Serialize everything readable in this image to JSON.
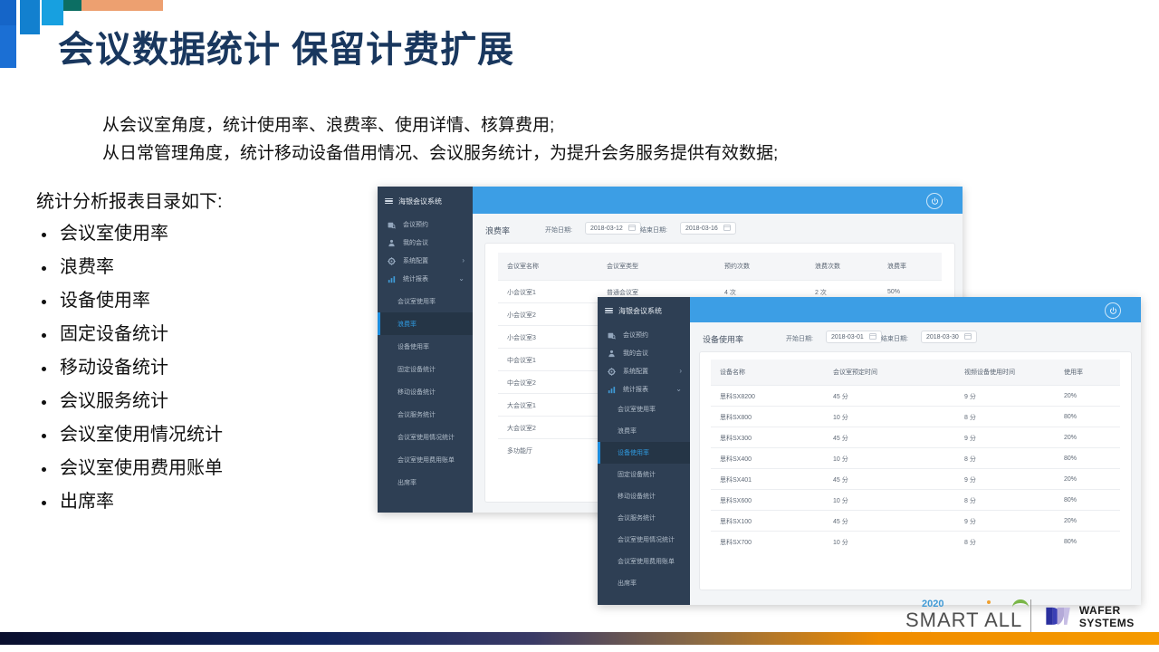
{
  "slide": {
    "title": "会议数据统计 保留计费扩展",
    "subtitle_line1": "从会议室角度，统计使用率、浪费率、使用详情、核算费用;",
    "subtitle_line2": "从日常管理角度，统计移动设备借用情况、会议服务统计，为提升会务服务提供有效数据;",
    "list_heading": "统计分析报表目录如下:",
    "bullets": [
      "会议室使用率",
      "浪费率",
      "设备使用率",
      "固定设备统计",
      "移动设备统计",
      "会议服务统计",
      "会议室使用情况统计",
      "会议室使用费用账单",
      "出席率"
    ]
  },
  "colors": {
    "title_navy": "#19375e",
    "accent_blue": "#3c9ee5",
    "sidebar_dark": "#2e3f54",
    "sidebar_active": "#253546",
    "active_text": "#2f9ae0",
    "deco_orange": "#eda070"
  },
  "app_back": {
    "brand": "海银会议系统",
    "hamburger_icon": "hamburger-icon",
    "power_icon": "power-icon",
    "nav": [
      {
        "label": "会议预约",
        "icon": "calendar-search-icon",
        "chevron": ""
      },
      {
        "label": "我的会议",
        "icon": "person-icon",
        "chevron": ""
      },
      {
        "label": "系统配置",
        "icon": "gear-icon",
        "chevron": "›"
      },
      {
        "label": "统计报表",
        "icon": "bar-chart-icon",
        "chevron": "⌄"
      }
    ],
    "subnav": [
      {
        "label": "会议室使用率",
        "active": false
      },
      {
        "label": "浪费率",
        "active": true
      },
      {
        "label": "设备使用率",
        "active": false
      },
      {
        "label": "固定设备统计",
        "active": false
      },
      {
        "label": "移动设备统计",
        "active": false
      },
      {
        "label": "会议服务统计",
        "active": false
      },
      {
        "label": "会议室使用情况统计",
        "active": false
      },
      {
        "label": "会议室使用费用账单",
        "active": false
      },
      {
        "label": "出席率",
        "active": false
      }
    ],
    "panel_title": "浪费率",
    "start_label": "开始日期:",
    "start_value": "2018-03-12",
    "end_label": "结束日期:",
    "end_value": "2018-03-16",
    "table": {
      "headers": [
        "会议室名称",
        "会议室类型",
        "预约次数",
        "浪费次数",
        "浪费率"
      ],
      "rows": [
        [
          "小会议室1",
          "普通会议室",
          "4 次",
          "2 次",
          "50%"
        ],
        [
          "小会议室2",
          "",
          "",
          "",
          ""
        ],
        [
          "小会议室3",
          "",
          "",
          "",
          ""
        ],
        [
          "中会议室1",
          "",
          "",
          "",
          ""
        ],
        [
          "中会议室2",
          "",
          "",
          "",
          ""
        ],
        [
          "大会议室1",
          "",
          "",
          "",
          ""
        ],
        [
          "大会议室2",
          "",
          "",
          "",
          ""
        ],
        [
          "多功能厅",
          "",
          "",
          "",
          ""
        ]
      ]
    }
  },
  "app_front": {
    "brand": "海银会议系统",
    "hamburger_icon": "hamburger-icon",
    "power_icon": "power-icon",
    "nav": [
      {
        "label": "会议预约",
        "icon": "calendar-search-icon",
        "chevron": ""
      },
      {
        "label": "我的会议",
        "icon": "person-icon",
        "chevron": ""
      },
      {
        "label": "系统配置",
        "icon": "gear-icon",
        "chevron": "›"
      },
      {
        "label": "统计报表",
        "icon": "bar-chart-icon",
        "chevron": "⌄"
      }
    ],
    "subnav": [
      {
        "label": "会议室使用率",
        "active": false
      },
      {
        "label": "浪费率",
        "active": false
      },
      {
        "label": "设备使用率",
        "active": true
      },
      {
        "label": "固定设备统计",
        "active": false
      },
      {
        "label": "移动设备统计",
        "active": false
      },
      {
        "label": "会议服务统计",
        "active": false
      },
      {
        "label": "会议室使用情况统计",
        "active": false
      },
      {
        "label": "会议室使用费用账单",
        "active": false
      },
      {
        "label": "出席率",
        "active": false
      }
    ],
    "panel_title": "设备使用率",
    "start_label": "开始日期:",
    "start_value": "2018-03-01",
    "end_label": "结束日期:",
    "end_value": "2018-03-30",
    "table": {
      "headers": [
        "设备名称",
        "会议室预定时间",
        "视频设备使用时间",
        "使用率"
      ],
      "rows": [
        [
          "思科SX8200",
          "45 分",
          "9 分",
          "20%"
        ],
        [
          "思科SX800",
          "10 分",
          "8 分",
          "80%"
        ],
        [
          "思科SX300",
          "45 分",
          "9 分",
          "20%"
        ],
        [
          "思科SX400",
          "10 分",
          "8 分",
          "80%"
        ],
        [
          "思科SX401",
          "45 分",
          "9 分",
          "20%"
        ],
        [
          "思科SX600",
          "10 分",
          "8 分",
          "80%"
        ],
        [
          "思科SX100",
          "45 分",
          "9 分",
          "20%"
        ],
        [
          "思科SX700",
          "10 分",
          "8 分",
          "80%"
        ]
      ]
    }
  },
  "footer": {
    "smart_year": "2020",
    "smart_name": "SMART ALL",
    "wafer_name": "WAFER SYSTEMS",
    "wafer_logo_icon": "wafer-w-logo-icon"
  }
}
